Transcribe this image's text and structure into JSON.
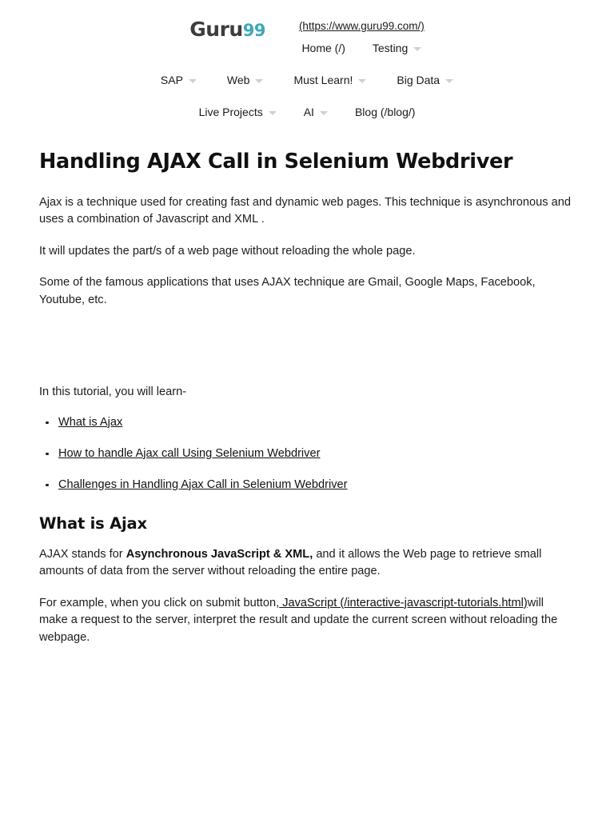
{
  "header": {
    "logo": {
      "word": "Guru",
      "number": "99"
    },
    "site_url": "(https://www.guru99.com/)",
    "nav_rows": [
      [
        {
          "label": "Home (/)",
          "caret": false
        },
        {
          "label": "Testing",
          "caret": true
        }
      ],
      [
        {
          "label": "SAP",
          "caret": true
        },
        {
          "label": "Web",
          "caret": true
        },
        {
          "label": "Must Learn!",
          "caret": true
        },
        {
          "label": "Big Data",
          "caret": true
        }
      ],
      [
        {
          "label": "Live Projects",
          "caret": true
        },
        {
          "label": "AI",
          "caret": true
        },
        {
          "label": "Blog (/blog/)",
          "caret": false
        }
      ]
    ]
  },
  "article": {
    "title": "Handling AJAX Call in Selenium Webdriver",
    "paragraph_1": "Ajax is a technique used for creating fast and dynamic web pages. This technique is asynchronous and uses a combination of Javascript and XML .",
    "paragraph_2": "It will updates the part/s of a web page without reloading the whole page.",
    "paragraph_3": "Some of the famous applications that uses AJAX technique are Gmail, Google Maps, Facebook, Youtube, etc.",
    "learn_intro": "In this tutorial, you will learn-",
    "toc": [
      "What is Ajax",
      "How to handle Ajax call Using Selenium Webdriver",
      "Challenges in Handling Ajax Call in Selenium Webdriver"
    ],
    "section_title": "What is Ajax",
    "definition": {
      "lead": "AJAX stands for ",
      "bold": "Asynchronous JavaScript & XML,",
      "rest": " and it allows the Web page to retrieve small amounts of data from the server without reloading the entire page."
    },
    "example": {
      "lead": "For example, when you click on submit button,",
      "link": " JavaScript (/interactive-javascript-tutorials.html)",
      "rest": "will make a request to the server, interpret the result and update the current screen without reloading the webpage."
    }
  },
  "colors": {
    "logo_number": "#3da9b8",
    "logo_word": "#3d3d3d",
    "text": "#1c1c1c",
    "caret": "#cfcfcf"
  }
}
